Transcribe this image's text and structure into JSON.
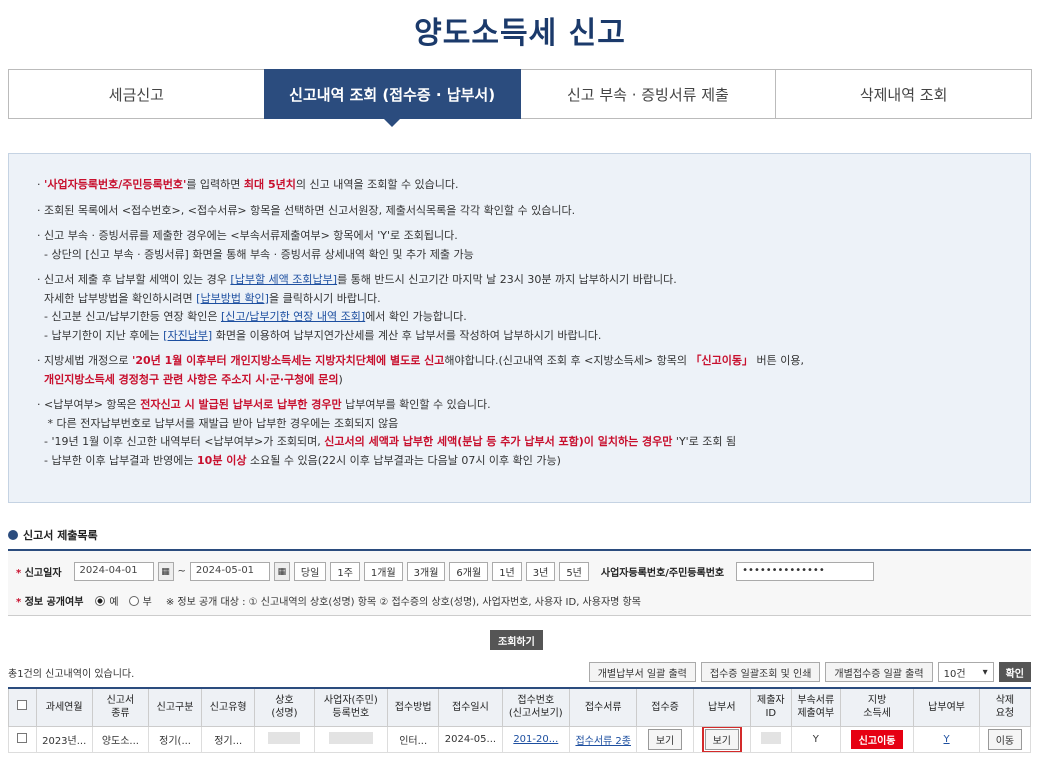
{
  "title": "양도소득세 신고",
  "tabs": [
    "세금신고",
    "신고내역 조회 (접수증 · 납부서)",
    "신고 부속 · 증빙서류 제출",
    "삭제내역 조회"
  ],
  "info": {
    "l1_a": "'사업자등록번호/주민등록번호'",
    "l1_b": "를 입력하면 ",
    "l1_c": "최대 5년치",
    "l1_d": "의 신고 내역을 조회할 수 있습니다.",
    "l2": "조회된 목록에서 <접수번호>, <접수서류> 항목을 선택하면 신고서원장, 제출서식목록을 각각 확인할 수 있습니다.",
    "l3": "신고 부속 · 증빙서류를 제출한 경우에는 <부속서류제출여부> 항목에서 'Y'로 조회됩니다.",
    "l4": "- 상단의 [신고 부속 · 증빙서류] 화면을 통해 부속 · 증빙서류 상세내역 확인 및 추가 제출 가능",
    "l5_a": "신고서 제출 후 납부할 세액이 있는 경우 ",
    "l5_b": "[납부할 세액 조회납부]",
    "l5_c": "를 통해 반드시 신고기간 마지막 날 23시 30분 까지 납부하시기 바랍니다.",
    "l6_a": "자세한 납부방법을 확인하시려면 ",
    "l6_b": "[납부방법 확인]",
    "l6_c": "을 클릭하시기 바랍니다.",
    "l7_a": "- 신고분 신고/납부기한등 연장 확인은 ",
    "l7_b": "[신고/납부기한 연장 내역 조회]",
    "l7_c": "에서 확인 가능합니다.",
    "l8_a": "- 납부기한이 지난 후에는 ",
    "l8_b": "[자진납부]",
    "l8_c": " 화면을 이용하여 납부지연가산세를 계산 후 납부서를 작성하여 납부하시기 바랍니다.",
    "l9_a": "지방세법 개정으로 ",
    "l9_b": "'20년 1월 이후부터 개인지방소득세는 지방자치단체에 별도로 신고",
    "l9_c": "해야합니다.(신고내역 조회 후 <지방소득세> 항목의 ",
    "l9_d": "「신고이동」",
    "l9_e": " 버튼 이용,",
    "l10": "개인지방소득세 경정청구 관련 사항은 주소지 시·군·구청에 문의",
    "l10_end": ")",
    "l11_a": "<납부여부> 항목은 ",
    "l11_b": "전자신고 시 발급된 납부서로 납부한 경우만",
    "l11_c": " 납부여부를 확인할 수 있습니다.",
    "l12": "* 다른 전자납부번호로 납부서를 재발급 받아 납부한 경우에는 조회되지 않음",
    "l13_a": "- '19년 1월 이후 신고한 내역부터 <납부여부>가 조회되며, ",
    "l13_b": "신고서의 세액과 납부한 세액(분납 등 추가 납부서 포함)이 일치하는 경우만",
    "l13_c": " 'Y'로 조회 됨",
    "l14_a": "- 납부한 이후 납부결과 반영에는 ",
    "l14_b": "10분 이상",
    "l14_c": " 소요될 수 있음(22시 이후 납부결과는 다음날 07시 이후 확인 가능)"
  },
  "section_title": "신고서 제출목록",
  "search": {
    "date_label": "신고일자",
    "date_from": "2024-04-01",
    "date_to": "2024-05-01",
    "period_buttons": [
      "당일",
      "1주",
      "1개월",
      "3개월",
      "6개월",
      "1년",
      "3년",
      "5년"
    ],
    "biz_label": "사업자등록번호/주민등록번호",
    "biz_value": "••••••••••••••",
    "info_label": "정보 공개여부",
    "opt_yes": "예",
    "opt_no": "부",
    "info_note": "※ 정보 공개 대상 : ① 신고내역의 상호(성명) 항목 ② 접수증의 상호(성명), 사업자번호, 사용자 ID, 사용자명 항목",
    "query_btn": "조회하기"
  },
  "result_count": "총1건의 신고내역이 있습니다.",
  "actions": [
    "개별납부서 일괄 출력",
    "접수증 일괄조회 및 인쇄",
    "개별접수증 일괄 출력"
  ],
  "page_size": "10건",
  "confirm_btn": "확인",
  "table": {
    "headers": [
      "",
      "과세연월",
      "신고서\n종류",
      "신고구분",
      "신고유형",
      "상호\n(성명)",
      "사업자(주민)\n등록번호",
      "접수방법",
      "접수일시",
      "접수번호\n(신고서보기)",
      "접수서류",
      "접수증",
      "납부서",
      "제출자\nID",
      "부속서류\n제출여부",
      "지방\n소득세",
      "납부여부",
      "삭제\n요청"
    ],
    "row": {
      "period": "2023년...",
      "kind": "양도소...",
      "type": "정기(...",
      "form": "정기...",
      "method": "인터...",
      "date": "2024-05...",
      "receipt_no": "201-20...",
      "docs": "접수서류 2종",
      "receipt": "보기",
      "payment": "보기",
      "attach": "Y",
      "local_tax": "신고이동",
      "paid": "Y",
      "delete": "이동"
    }
  },
  "colors": {
    "brand": "#2b4c7e",
    "accent_red": "#c8102e"
  }
}
